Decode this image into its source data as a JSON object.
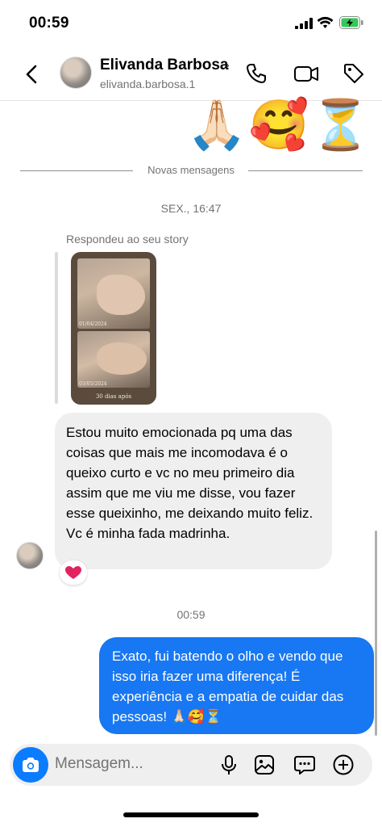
{
  "status_bar": {
    "time": "00:59"
  },
  "header": {
    "name": "Elivanda Barbosa",
    "chevron": "›",
    "username": "elivanda.barbosa.1"
  },
  "top_emojis": "🙏🏻🥰⏳",
  "divider_label": "Novas mensagens",
  "timestamp_1": "SEX., 16:47",
  "reply_label": "Respondeu ao seu story",
  "story": {
    "date_1": "01/04/2024",
    "date_2": "03/05/2024",
    "caption": "30 dias após"
  },
  "incoming_message": "Estou muito emocionada pq uma das coisas que mais me incomodava é o queixo curto e vc no meu primeiro dia assim que me viu  me disse, vou fazer esse queixinho, me deixando muito feliz. Vc é minha fada madrinha.",
  "reaction": "❤️",
  "timestamp_2": "00:59",
  "outgoing_message": "Exato, fui batendo o olho e vendo que isso iria fazer uma diferença! É experiência e a empatia de cuidar das pessoas! 🙏🏻🥰⏳",
  "composer": {
    "placeholder": "Mensagem..."
  },
  "colors": {
    "accent": "#1877f2",
    "camera": "#0a7cff",
    "incoming_bubble": "#efefef",
    "battery": "#34c759"
  },
  "icons": [
    "signal-icon",
    "wifi-icon",
    "battery-icon",
    "back-icon",
    "phone-icon",
    "video-icon",
    "tag-icon",
    "camera-icon",
    "mic-icon",
    "image-icon",
    "sticker-icon",
    "plus-icon"
  ]
}
